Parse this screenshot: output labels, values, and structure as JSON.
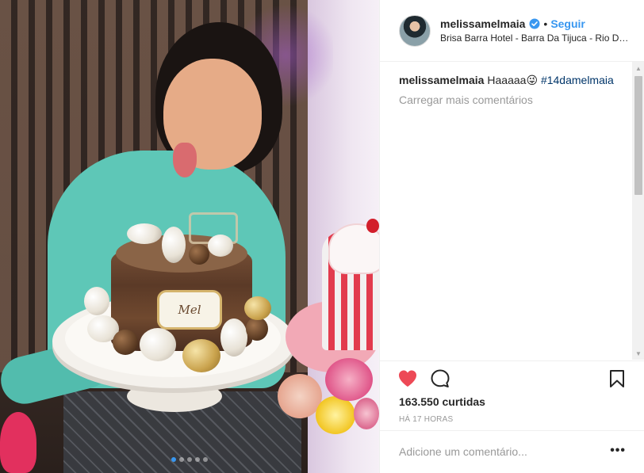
{
  "post": {
    "username": "melissamelmaia",
    "separator": "•",
    "follow_label": "Seguir",
    "location": "Brisa Barra Hotel - Barra Da Tijuca - Rio De Janeiro",
    "caption_text": "Haaaaa😜",
    "caption_hashtag": "#14damelmaia",
    "load_more_label": "Carregar mais comentários",
    "likes_label": "163.550 curtidas",
    "time_label": "HÁ 17 HORAS",
    "comment_placeholder": "Adicione um comentário...",
    "more_label": "•••"
  },
  "photo": {
    "cake_tag_text": "Mel",
    "carousel": {
      "count": 5,
      "active_index": 0
    }
  },
  "icons": {
    "verified": "verified-badge-icon",
    "like": "heart-icon",
    "comment": "comment-bubble-icon",
    "save": "bookmark-icon",
    "more": "more-options-icon"
  },
  "colors": {
    "accent": "#3897f0",
    "like": "#ed4956",
    "hashtag": "#003569",
    "muted": "#999999",
    "text": "#262626",
    "border": "#efefef"
  }
}
